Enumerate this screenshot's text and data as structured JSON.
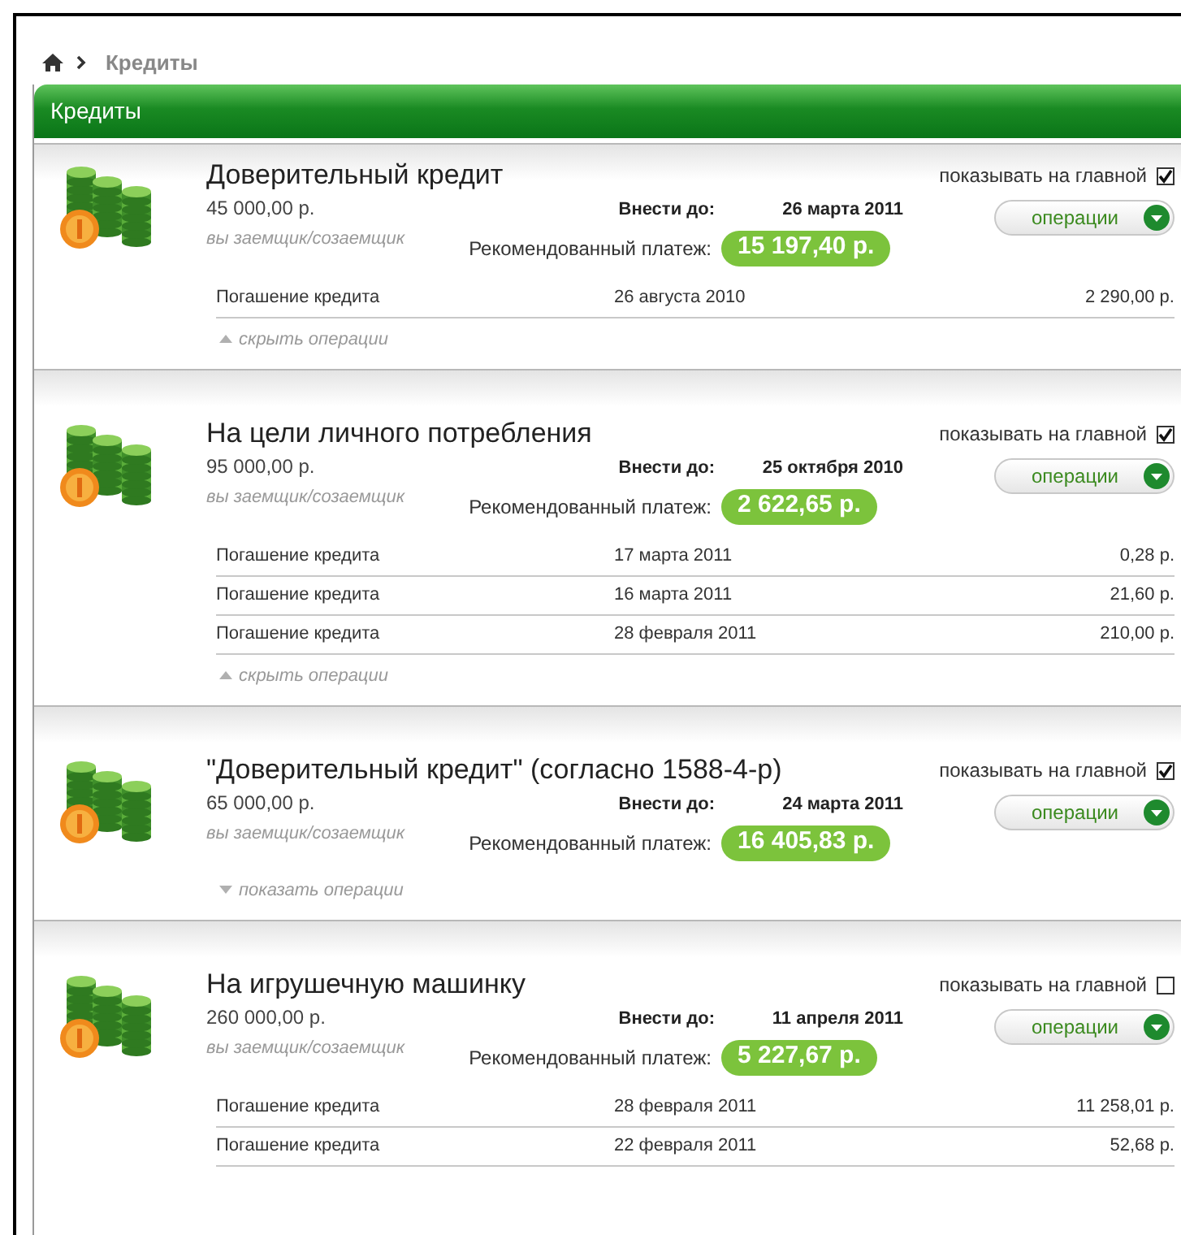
{
  "breadcrumb": {
    "current": "Кредиты"
  },
  "panel": {
    "title": "Кредиты"
  },
  "loans": [
    {
      "title": "Доверительный кредит",
      "amount": "45 000,00 р.",
      "role": "вы заемщик/созаемщик",
      "due_label": "Внести до:",
      "due_date": "26 марта 2011",
      "payment_label": "Рекомендованный платеж:",
      "payment": "15 197,40 р.",
      "show_label": "показывать на главной",
      "show_on_main": true,
      "ops_button": "операции",
      "operations": [
        {
          "name": "Погашение кредита",
          "date": "26 августа 2010",
          "amount": "2 290,00 р."
        }
      ],
      "toggle": {
        "label": "скрыть операции",
        "expanded": true
      }
    },
    {
      "title": "На цели личного потребления",
      "amount": "95 000,00 р.",
      "role": "вы заемщик/созаемщик",
      "due_label": "Внести до:",
      "due_date": "25 октября 2010",
      "payment_label": "Рекомендованный платеж:",
      "payment": "2 622,65 р.",
      "show_label": "показывать на главной",
      "show_on_main": true,
      "ops_button": "операции",
      "operations": [
        {
          "name": "Погашение кредита",
          "date": "17 марта 2011",
          "amount": "0,28 р."
        },
        {
          "name": "Погашение кредита",
          "date": "16 марта 2011",
          "amount": "21,60 р."
        },
        {
          "name": "Погашение кредита",
          "date": "28 февраля 2011",
          "amount": "210,00 р."
        }
      ],
      "toggle": {
        "label": "скрыть операции",
        "expanded": true
      }
    },
    {
      "title": "\"Доверительный кредит\" (согласно 1588-4-р)",
      "amount": "65 000,00 р.",
      "role": "вы заемщик/созаемщик",
      "due_label": "Внести до:",
      "due_date": "24 марта 2011",
      "payment_label": "Рекомендованный платеж:",
      "payment": "16 405,83 р.",
      "show_label": "показывать на главной",
      "show_on_main": true,
      "ops_button": "операции",
      "toggle": {
        "label": "показать операции",
        "expanded": false
      }
    },
    {
      "title": "На игрушечную машинку",
      "amount": "260 000,00 р.",
      "role": "вы заемщик/созаемщик",
      "due_label": "Внести до:",
      "due_date": "11 апреля 2011",
      "payment_label": "Рекомендованный платеж:",
      "payment": "5 227,67 р.",
      "show_label": "показывать на главной",
      "show_on_main": false,
      "ops_button": "операции",
      "operations": [
        {
          "name": "Погашение кредита",
          "date": "28 февраля 2011",
          "amount": "11 258,01 р."
        },
        {
          "name": "Погашение кредита",
          "date": "22 февраля 2011",
          "amount": "52,68 р."
        }
      ]
    }
  ]
}
